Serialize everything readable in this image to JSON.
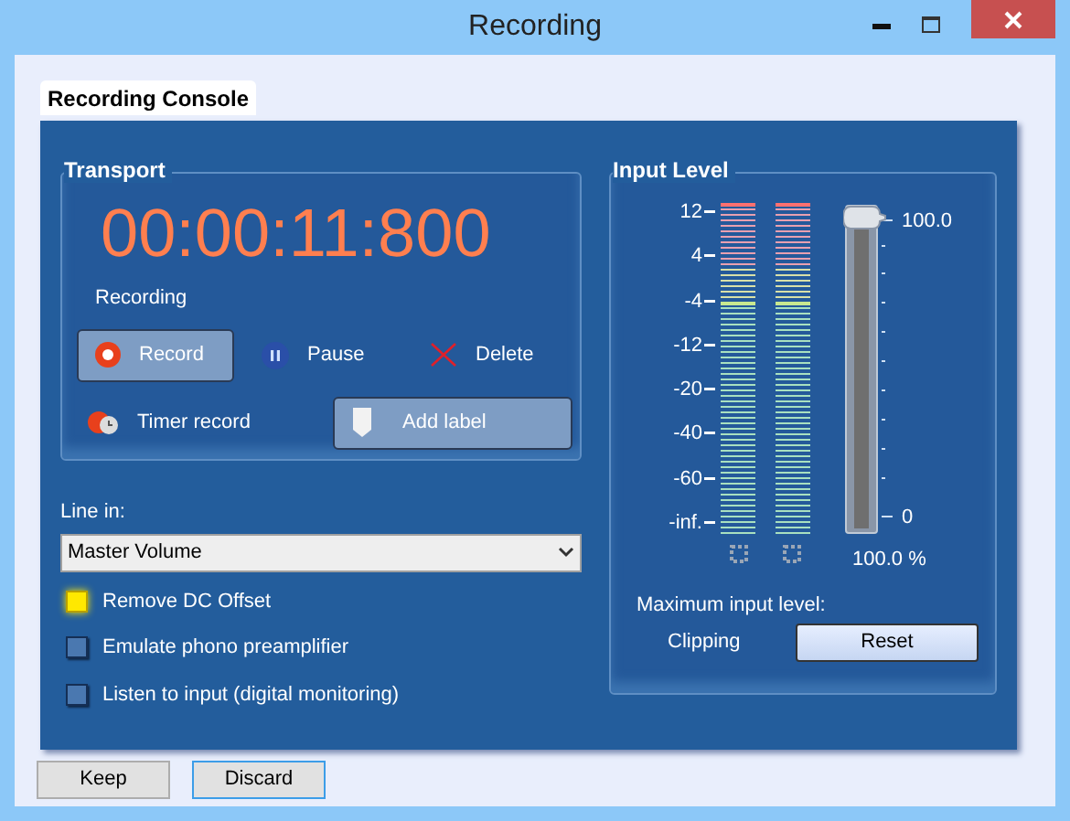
{
  "window": {
    "title": "Recording"
  },
  "console": {
    "title": "Recording Console"
  },
  "transport": {
    "title": "Transport",
    "time": "00:00:11:800",
    "status": "Recording",
    "buttons": [
      {
        "label": "Record",
        "kind": "record",
        "raised": true
      },
      {
        "label": "Pause",
        "kind": "pause",
        "raised": false
      },
      {
        "label": "Delete",
        "kind": "delete",
        "raised": false
      },
      {
        "label": "Timer record",
        "kind": "timer",
        "raised": false
      },
      {
        "label": "Add label",
        "kind": "label",
        "raised": true
      }
    ]
  },
  "line_in": {
    "label": "Line in:",
    "value": "Master Volume"
  },
  "options": [
    {
      "label": "Remove DC Offset",
      "checked": true
    },
    {
      "label": "Emulate phono preamplifier",
      "checked": false
    },
    {
      "label": "Listen to input (digital monitoring)",
      "checked": false
    }
  ],
  "input_level": {
    "title": "Input Level",
    "scale": [
      "12",
      "4",
      "-4",
      "-12",
      "-20",
      "-40",
      "-60",
      "-inf."
    ],
    "gain": {
      "max": "100.0",
      "min": "0",
      "level": 1,
      "reading": "100.0 %"
    },
    "max_label": "Maximum input level:",
    "max_value": "Clipping",
    "reset": "Reset"
  },
  "footer_buttons": [
    "Keep",
    "Discard"
  ]
}
